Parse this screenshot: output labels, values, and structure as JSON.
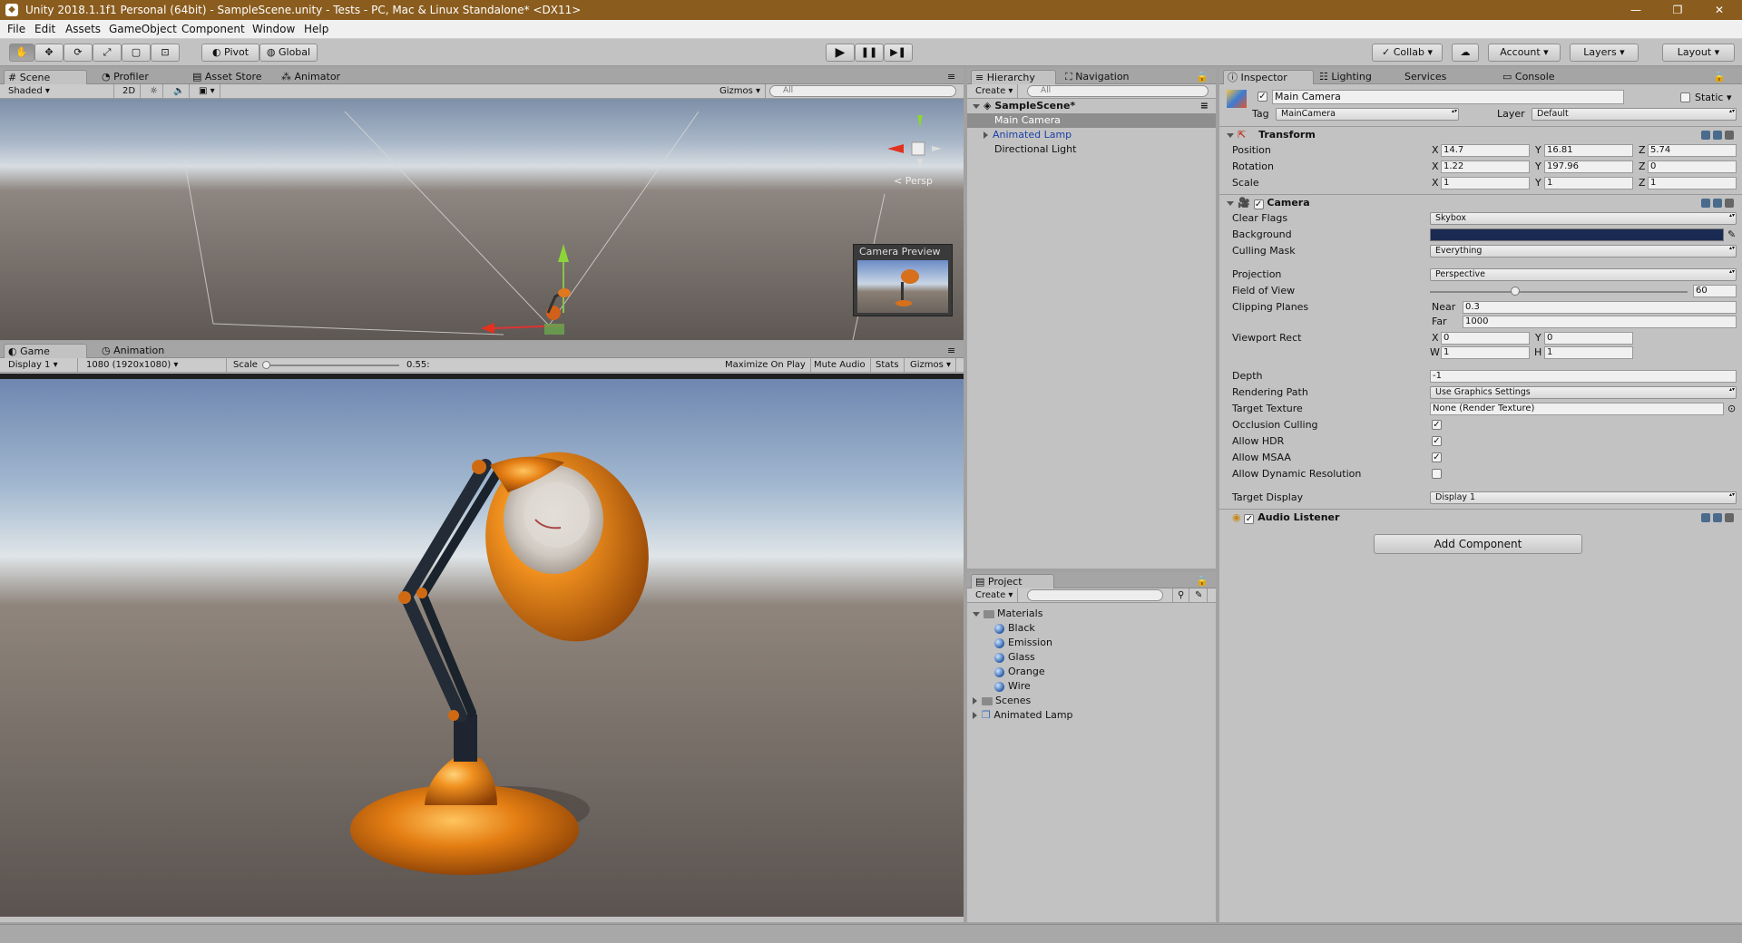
{
  "window": {
    "title": "Unity 2018.1.1f1 Personal (64bit) - SampleScene.unity - Tests - PC, Mac & Linux Standalone* <DX11>",
    "minimize": "—",
    "maximize": "❐",
    "close": "✕"
  },
  "menu": [
    "File",
    "Edit",
    "Assets",
    "GameObject",
    "Component",
    "Window",
    "Help"
  ],
  "toolbar": {
    "pivot": "Pivot",
    "global": "Global",
    "collab": "Collab",
    "account": "Account",
    "layers": "Layers",
    "layout": "Layout"
  },
  "scene": {
    "tabs": [
      "Scene",
      "Profiler",
      "Asset Store",
      "Animator"
    ],
    "shading": "Shaded",
    "mode_2d": "2D",
    "gizmos": "Gizmos",
    "search_placeholder": "All",
    "persp": "Persp",
    "camera_preview": "Camera Preview"
  },
  "game": {
    "tabs": [
      "Game",
      "Animation"
    ],
    "display": "Display 1",
    "resolution": "1080 (1920x1080)",
    "scale_label": "Scale",
    "scale_value": "0.55:",
    "scale_fraction": 0.02,
    "maximize": "Maximize On Play",
    "mute": "Mute Audio",
    "stats": "Stats",
    "gizmos": "Gizmos"
  },
  "hierarchy": {
    "tabs": [
      "Hierarchy",
      "Navigation"
    ],
    "create": "Create",
    "search_placeholder": "All",
    "scene": "SampleScene*",
    "items": [
      "Main Camera",
      "Animated Lamp",
      "Directional Light"
    ]
  },
  "project": {
    "tab": "Project",
    "create": "Create",
    "materials_folder": "Materials",
    "materials": [
      "Black",
      "Emission",
      "Glass",
      "Orange",
      "Wire"
    ],
    "scenes_folder": "Scenes",
    "prefab": "Animated Lamp"
  },
  "inspector": {
    "tabs": [
      "Inspector",
      "Lighting",
      "Services",
      "Console"
    ],
    "name": "Main Camera",
    "static": "Static",
    "tag_label": "Tag",
    "tag": "MainCamera",
    "layer_label": "Layer",
    "layer": "Default",
    "transform": {
      "title": "Transform",
      "position_label": "Position",
      "rotation_label": "Rotation",
      "scale_label": "Scale",
      "position": [
        "14.7",
        "16.81",
        "5.74"
      ],
      "rotation": [
        "1.22",
        "197.96",
        "0"
      ],
      "scale": [
        "1",
        "1",
        "1"
      ]
    },
    "axes": [
      "X",
      "Y",
      "Z"
    ],
    "camera": {
      "title": "Camera",
      "clear_flags_label": "Clear Flags",
      "clear_flags": "Skybox",
      "background_label": "Background",
      "background_color": "#1a2a52",
      "culling_mask_label": "Culling Mask",
      "culling_mask": "Everything",
      "projection_label": "Projection",
      "projection": "Perspective",
      "fov_label": "Field of View",
      "fov": "60",
      "fov_fraction": 0.33,
      "clipping_label": "Clipping Planes",
      "near_label": "Near",
      "near": "0.3",
      "far_label": "Far",
      "far": "1000",
      "viewport_label": "Viewport Rect",
      "vx": "0",
      "vy": "0",
      "vw": "1",
      "vh": "1",
      "w_label": "W",
      "h_label": "H",
      "depth_label": "Depth",
      "depth": "-1",
      "rendering_path_label": "Rendering Path",
      "rendering_path": "Use Graphics Settings",
      "target_texture_label": "Target Texture",
      "target_texture": "None (Render Texture)",
      "occlusion_label": "Occlusion Culling",
      "hdr_label": "Allow HDR",
      "msaa_label": "Allow MSAA",
      "dynres_label": "Allow Dynamic Resolution",
      "target_display_label": "Target Display",
      "target_display": "Display 1"
    },
    "audio_listener": "Audio Listener",
    "add_component": "Add Component"
  }
}
